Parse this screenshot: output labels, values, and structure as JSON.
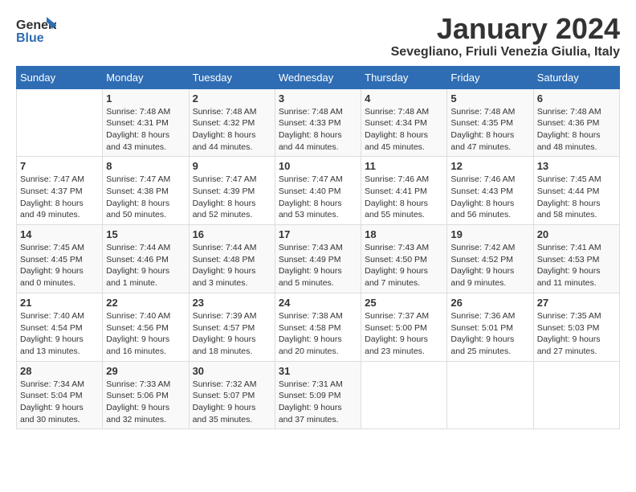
{
  "logo": {
    "general": "General",
    "blue": "Blue"
  },
  "header": {
    "month": "January 2024",
    "location": "Sevegliano, Friuli Venezia Giulia, Italy"
  },
  "weekdays": [
    "Sunday",
    "Monday",
    "Tuesday",
    "Wednesday",
    "Thursday",
    "Friday",
    "Saturday"
  ],
  "weeks": [
    [
      {
        "day": "",
        "sunrise": "",
        "sunset": "",
        "daylight": ""
      },
      {
        "day": "1",
        "sunrise": "Sunrise: 7:48 AM",
        "sunset": "Sunset: 4:31 PM",
        "daylight": "Daylight: 8 hours and 43 minutes."
      },
      {
        "day": "2",
        "sunrise": "Sunrise: 7:48 AM",
        "sunset": "Sunset: 4:32 PM",
        "daylight": "Daylight: 8 hours and 44 minutes."
      },
      {
        "day": "3",
        "sunrise": "Sunrise: 7:48 AM",
        "sunset": "Sunset: 4:33 PM",
        "daylight": "Daylight: 8 hours and 44 minutes."
      },
      {
        "day": "4",
        "sunrise": "Sunrise: 7:48 AM",
        "sunset": "Sunset: 4:34 PM",
        "daylight": "Daylight: 8 hours and 45 minutes."
      },
      {
        "day": "5",
        "sunrise": "Sunrise: 7:48 AM",
        "sunset": "Sunset: 4:35 PM",
        "daylight": "Daylight: 8 hours and 47 minutes."
      },
      {
        "day": "6",
        "sunrise": "Sunrise: 7:48 AM",
        "sunset": "Sunset: 4:36 PM",
        "daylight": "Daylight: 8 hours and 48 minutes."
      }
    ],
    [
      {
        "day": "7",
        "sunrise": "Sunrise: 7:47 AM",
        "sunset": "Sunset: 4:37 PM",
        "daylight": "Daylight: 8 hours and 49 minutes."
      },
      {
        "day": "8",
        "sunrise": "Sunrise: 7:47 AM",
        "sunset": "Sunset: 4:38 PM",
        "daylight": "Daylight: 8 hours and 50 minutes."
      },
      {
        "day": "9",
        "sunrise": "Sunrise: 7:47 AM",
        "sunset": "Sunset: 4:39 PM",
        "daylight": "Daylight: 8 hours and 52 minutes."
      },
      {
        "day": "10",
        "sunrise": "Sunrise: 7:47 AM",
        "sunset": "Sunset: 4:40 PM",
        "daylight": "Daylight: 8 hours and 53 minutes."
      },
      {
        "day": "11",
        "sunrise": "Sunrise: 7:46 AM",
        "sunset": "Sunset: 4:41 PM",
        "daylight": "Daylight: 8 hours and 55 minutes."
      },
      {
        "day": "12",
        "sunrise": "Sunrise: 7:46 AM",
        "sunset": "Sunset: 4:43 PM",
        "daylight": "Daylight: 8 hours and 56 minutes."
      },
      {
        "day": "13",
        "sunrise": "Sunrise: 7:45 AM",
        "sunset": "Sunset: 4:44 PM",
        "daylight": "Daylight: 8 hours and 58 minutes."
      }
    ],
    [
      {
        "day": "14",
        "sunrise": "Sunrise: 7:45 AM",
        "sunset": "Sunset: 4:45 PM",
        "daylight": "Daylight: 9 hours and 0 minutes."
      },
      {
        "day": "15",
        "sunrise": "Sunrise: 7:44 AM",
        "sunset": "Sunset: 4:46 PM",
        "daylight": "Daylight: 9 hours and 1 minute."
      },
      {
        "day": "16",
        "sunrise": "Sunrise: 7:44 AM",
        "sunset": "Sunset: 4:48 PM",
        "daylight": "Daylight: 9 hours and 3 minutes."
      },
      {
        "day": "17",
        "sunrise": "Sunrise: 7:43 AM",
        "sunset": "Sunset: 4:49 PM",
        "daylight": "Daylight: 9 hours and 5 minutes."
      },
      {
        "day": "18",
        "sunrise": "Sunrise: 7:43 AM",
        "sunset": "Sunset: 4:50 PM",
        "daylight": "Daylight: 9 hours and 7 minutes."
      },
      {
        "day": "19",
        "sunrise": "Sunrise: 7:42 AM",
        "sunset": "Sunset: 4:52 PM",
        "daylight": "Daylight: 9 hours and 9 minutes."
      },
      {
        "day": "20",
        "sunrise": "Sunrise: 7:41 AM",
        "sunset": "Sunset: 4:53 PM",
        "daylight": "Daylight: 9 hours and 11 minutes."
      }
    ],
    [
      {
        "day": "21",
        "sunrise": "Sunrise: 7:40 AM",
        "sunset": "Sunset: 4:54 PM",
        "daylight": "Daylight: 9 hours and 13 minutes."
      },
      {
        "day": "22",
        "sunrise": "Sunrise: 7:40 AM",
        "sunset": "Sunset: 4:56 PM",
        "daylight": "Daylight: 9 hours and 16 minutes."
      },
      {
        "day": "23",
        "sunrise": "Sunrise: 7:39 AM",
        "sunset": "Sunset: 4:57 PM",
        "daylight": "Daylight: 9 hours and 18 minutes."
      },
      {
        "day": "24",
        "sunrise": "Sunrise: 7:38 AM",
        "sunset": "Sunset: 4:58 PM",
        "daylight": "Daylight: 9 hours and 20 minutes."
      },
      {
        "day": "25",
        "sunrise": "Sunrise: 7:37 AM",
        "sunset": "Sunset: 5:00 PM",
        "daylight": "Daylight: 9 hours and 23 minutes."
      },
      {
        "day": "26",
        "sunrise": "Sunrise: 7:36 AM",
        "sunset": "Sunset: 5:01 PM",
        "daylight": "Daylight: 9 hours and 25 minutes."
      },
      {
        "day": "27",
        "sunrise": "Sunrise: 7:35 AM",
        "sunset": "Sunset: 5:03 PM",
        "daylight": "Daylight: 9 hours and 27 minutes."
      }
    ],
    [
      {
        "day": "28",
        "sunrise": "Sunrise: 7:34 AM",
        "sunset": "Sunset: 5:04 PM",
        "daylight": "Daylight: 9 hours and 30 minutes."
      },
      {
        "day": "29",
        "sunrise": "Sunrise: 7:33 AM",
        "sunset": "Sunset: 5:06 PM",
        "daylight": "Daylight: 9 hours and 32 minutes."
      },
      {
        "day": "30",
        "sunrise": "Sunrise: 7:32 AM",
        "sunset": "Sunset: 5:07 PM",
        "daylight": "Daylight: 9 hours and 35 minutes."
      },
      {
        "day": "31",
        "sunrise": "Sunrise: 7:31 AM",
        "sunset": "Sunset: 5:09 PM",
        "daylight": "Daylight: 9 hours and 37 minutes."
      },
      {
        "day": "",
        "sunrise": "",
        "sunset": "",
        "daylight": ""
      },
      {
        "day": "",
        "sunrise": "",
        "sunset": "",
        "daylight": ""
      },
      {
        "day": "",
        "sunrise": "",
        "sunset": "",
        "daylight": ""
      }
    ]
  ]
}
